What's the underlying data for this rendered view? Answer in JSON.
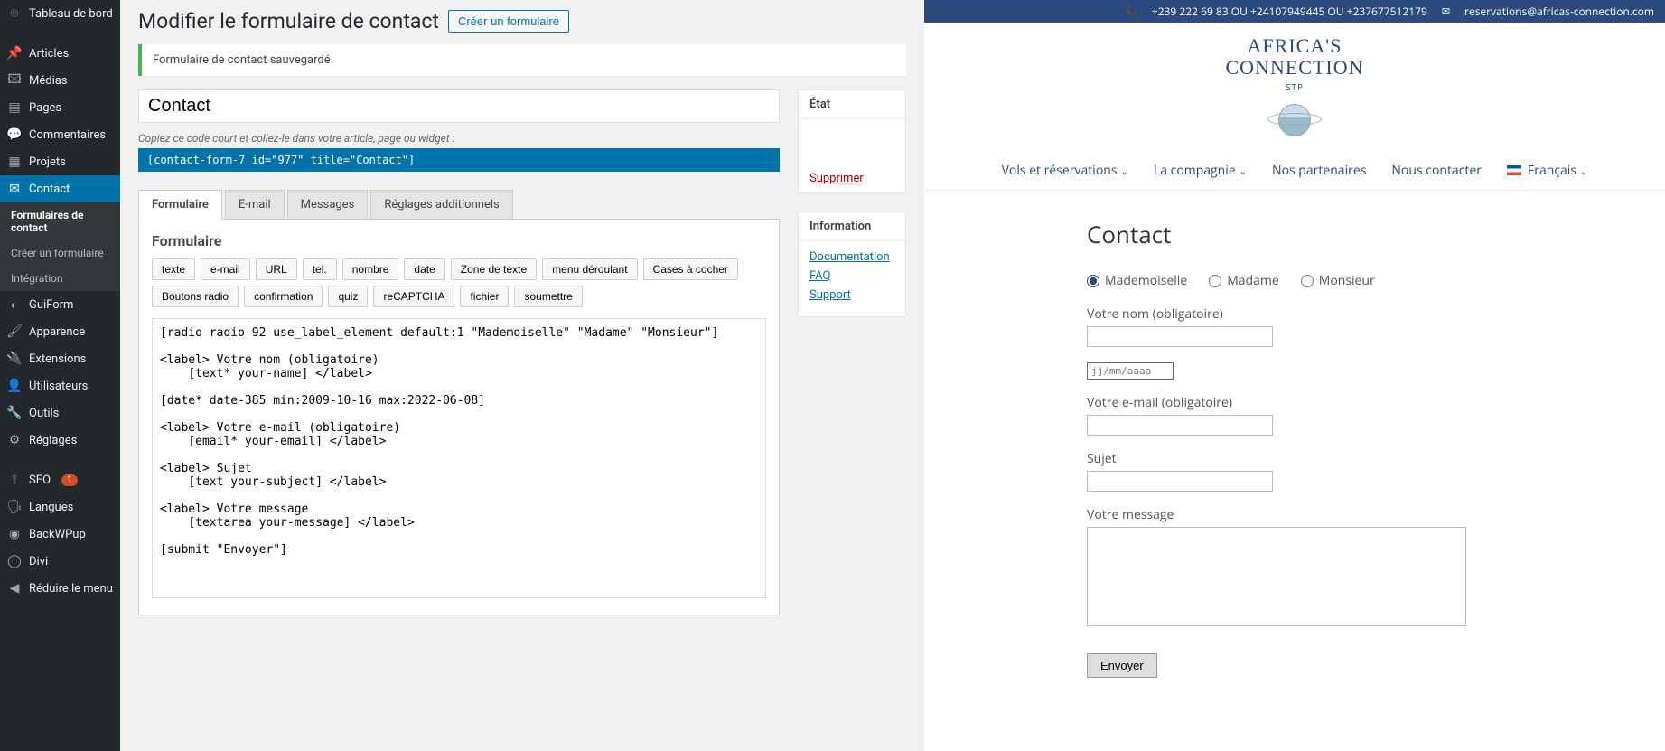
{
  "sidebar": {
    "items": [
      {
        "label": "Tableau de bord"
      },
      {
        "label": "Articles"
      },
      {
        "label": "Médias"
      },
      {
        "label": "Pages"
      },
      {
        "label": "Commentaires"
      },
      {
        "label": "Projets"
      },
      {
        "label": "Contact"
      },
      {
        "label": "GuiForm"
      },
      {
        "label": "Apparence"
      },
      {
        "label": "Extensions"
      },
      {
        "label": "Utilisateurs"
      },
      {
        "label": "Outils"
      },
      {
        "label": "Réglages"
      },
      {
        "label": "SEO"
      },
      {
        "label": "Langues"
      },
      {
        "label": "BackWPup"
      },
      {
        "label": "Divi"
      },
      {
        "label": "Réduire le menu"
      }
    ],
    "sub": {
      "forms": "Formulaires de contact",
      "create": "Créer un formulaire",
      "integration": "Intégration"
    },
    "seo_badge": "1"
  },
  "main": {
    "title": "Modifier le formulaire de contact",
    "create_btn": "Créer un formulaire",
    "notice": "Formulaire de contact sauvegardé.",
    "form_name": "Contact",
    "shortcode_help": "Copiez ce code court et collez-le dans votre article, page ou widget :",
    "shortcode": "[contact-form-7 id=\"977\" title=\"Contact\"]",
    "tabs": [
      "Formulaire",
      "E-mail",
      "Messages",
      "Réglages additionnels"
    ],
    "panel_title": "Formulaire",
    "tag_buttons": [
      "texte",
      "e-mail",
      "URL",
      "tel.",
      "nombre",
      "date",
      "Zone de texte",
      "menu déroulant",
      "Cases à cocher",
      "Boutons radio",
      "confirmation",
      "quiz",
      "reCAPTCHA",
      "fichier",
      "soumettre"
    ],
    "form_code": "[radio radio-92 use_label_element default:1 \"Mademoiselle\" \"Madame\" \"Monsieur\"]\n\n<label> Votre nom (obligatoire)\n    [text* your-name] </label>\n\n[date* date-385 min:2009-10-16 max:2022-06-08]\n\n<label> Votre e-mail (obligatoire)\n    [email* your-email] </label>\n\n<label> Sujet\n    [text your-subject] </label>\n\n<label> Votre message\n    [textarea your-message] </label>\n\n[submit \"Envoyer\"]"
  },
  "sidebox": {
    "status_title": "État",
    "delete": "Supprimer",
    "info_title": "Information",
    "links": {
      "doc": "Documentation",
      "faq": "FAQ",
      "support": "Support"
    }
  },
  "front": {
    "phone": "+239 222 69 83 OU +24107949445 OU +237677512179",
    "email": "reservations@africas-connection.com",
    "logo_top": "AFRICA'S",
    "logo_mid": "CONNECTION",
    "logo_sub": "STP",
    "nav": [
      "Vols et réservations",
      "La compagnie",
      "Nos partenaires",
      "Nous contacter",
      "Français"
    ],
    "h1": "Contact",
    "radios": [
      "Mademoiselle",
      "Madame",
      "Monsieur"
    ],
    "labels": {
      "name": "Votre nom (obligatoire)",
      "email": "Votre e-mail (obligatoire)",
      "subject": "Sujet",
      "message": "Votre message"
    },
    "date_placeholder": "jj/mm/aaaa",
    "submit": "Envoyer"
  }
}
